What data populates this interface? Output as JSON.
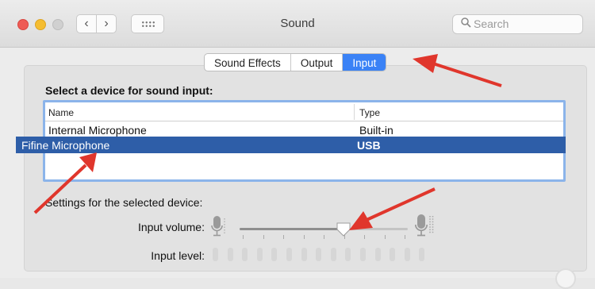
{
  "window": {
    "title": "Sound",
    "search_placeholder": "Search"
  },
  "toolbar": {
    "back_icon": "chevron-left-icon",
    "forward_icon": "chevron-right-icon",
    "grid_icon": "grid-icon",
    "search_icon": "search-icon"
  },
  "tabs": [
    {
      "label": "Sound Effects",
      "selected": false
    },
    {
      "label": "Output",
      "selected": false
    },
    {
      "label": "Input",
      "selected": true
    }
  ],
  "input": {
    "heading": "Select a device for sound input:",
    "columns": {
      "name": "Name",
      "type": "Type"
    },
    "devices": [
      {
        "name": "Internal Microphone",
        "type": "Built-in",
        "selected": false
      },
      {
        "name": "Fifine Microphone",
        "type": "USB",
        "selected": true
      }
    ],
    "settings_heading": "Settings for the selected device:",
    "volume_label": "Input volume:",
    "volume_fraction": 0.62,
    "level_label": "Input level:",
    "level_segments": 15,
    "level_active": 0
  },
  "colors": {
    "accent": "#3a82f6",
    "selection": "#2e5ea8",
    "annotation_arrow": "#e0362c"
  }
}
